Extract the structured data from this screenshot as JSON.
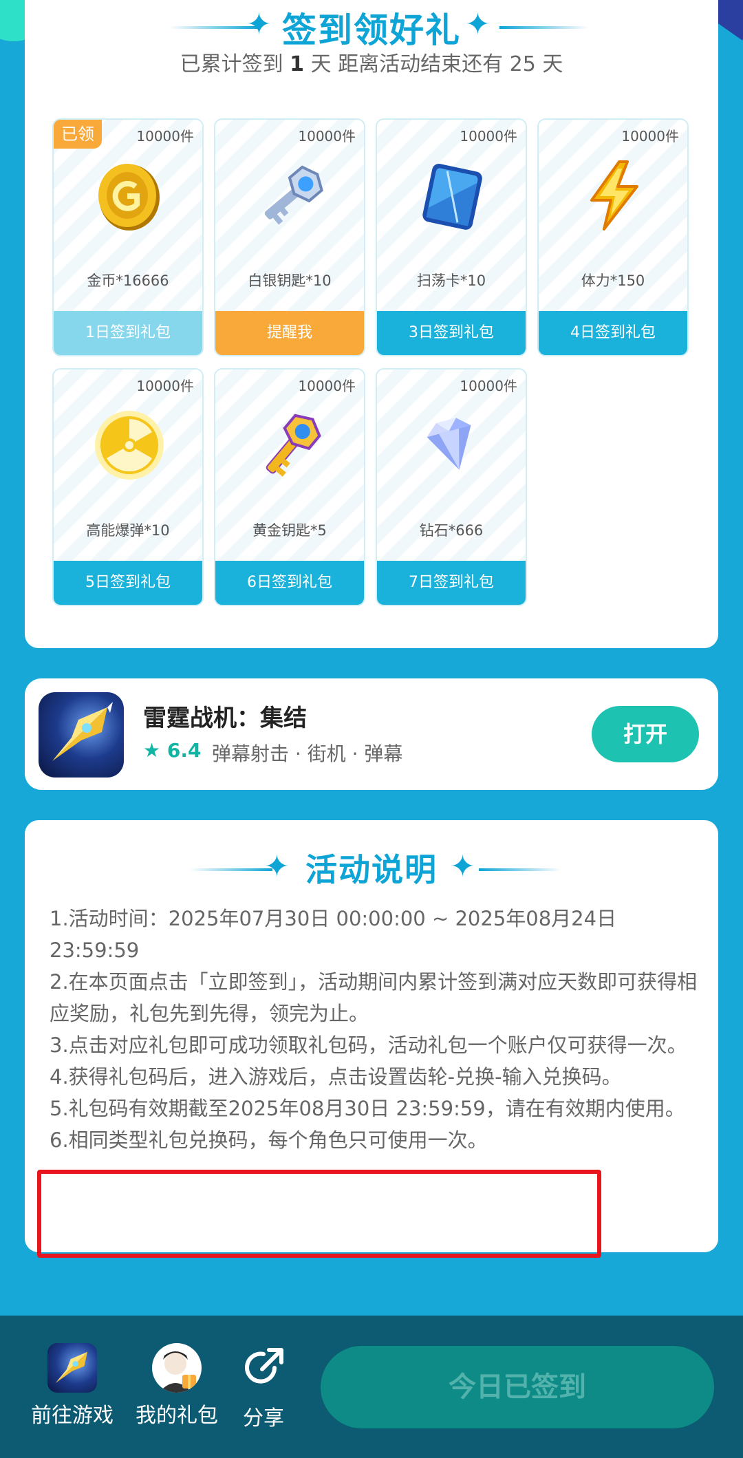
{
  "sign_in": {
    "title": "签到领好礼",
    "subtitle_prefix": "已累计签到",
    "days_count": "1",
    "subtitle_mid": "天  距离活动结束还有",
    "remaining_days": "25",
    "subtitle_suffix": "天",
    "gifts": [
      {
        "qty": "10000件",
        "name": "金币*16666",
        "button": "1日签到礼包",
        "claimed_badge": "已领",
        "icon": "gold-coin-icon",
        "state": "claimed"
      },
      {
        "qty": "10000件",
        "name": "白银钥匙*10",
        "button": "提醒我",
        "icon": "silver-key-icon",
        "state": "remind"
      },
      {
        "qty": "10000件",
        "name": "扫荡卡*10",
        "button": "3日签到礼包",
        "icon": "sweep-card-icon",
        "state": "normal"
      },
      {
        "qty": "10000件",
        "name": "体力*150",
        "button": "4日签到礼包",
        "icon": "lightning-icon",
        "state": "normal"
      },
      {
        "qty": "10000件",
        "name": "高能爆弹*10",
        "button": "5日签到礼包",
        "icon": "radiation-bomb-icon",
        "state": "normal"
      },
      {
        "qty": "10000件",
        "name": "黄金钥匙*5",
        "button": "6日签到礼包",
        "icon": "gold-key-icon",
        "state": "normal"
      },
      {
        "qty": "10000件",
        "name": "钻石*666",
        "button": "7日签到礼包",
        "icon": "diamond-icon",
        "state": "normal"
      }
    ]
  },
  "game": {
    "name": "雷霆战机：集结",
    "rating": "6.4",
    "tags": "弹幕射击 · 街机 · 弹幕",
    "open_label": "打开"
  },
  "rules": {
    "title": "活动说明",
    "items": [
      "1.活动时间：2025年07月30日 00:00:00 ~ 2025年08月24日 23:59:59",
      "2.在本页面点击「立即签到」，活动期间内累计签到满对应天数即可获得相应奖励，礼包先到先得，领完为止。",
      "3.点击对应礼包即可成功领取礼包码，活动礼包一个账户仅可获得一次。",
      "4.获得礼包码后，进入游戏后，点击设置齿轮-兑换-输入兑换码。",
      "5.礼包码有效期截至2025年08月30日 23:59:59，请在有效期内使用。",
      "6.相同类型礼包兑换码，每个角色只可使用一次。"
    ]
  },
  "bottom_bar": {
    "goto_game": "前往游戏",
    "my_gifts": "我的礼包",
    "share": "分享",
    "signed_label": "今日已签到"
  },
  "colors": {
    "accent": "#0fa4d6",
    "background": "#17a8d8",
    "orange": "#f8a93a",
    "teal": "#1dc3b0",
    "bottom_bar": "#0c5b73",
    "highlight": "#e8141e"
  }
}
